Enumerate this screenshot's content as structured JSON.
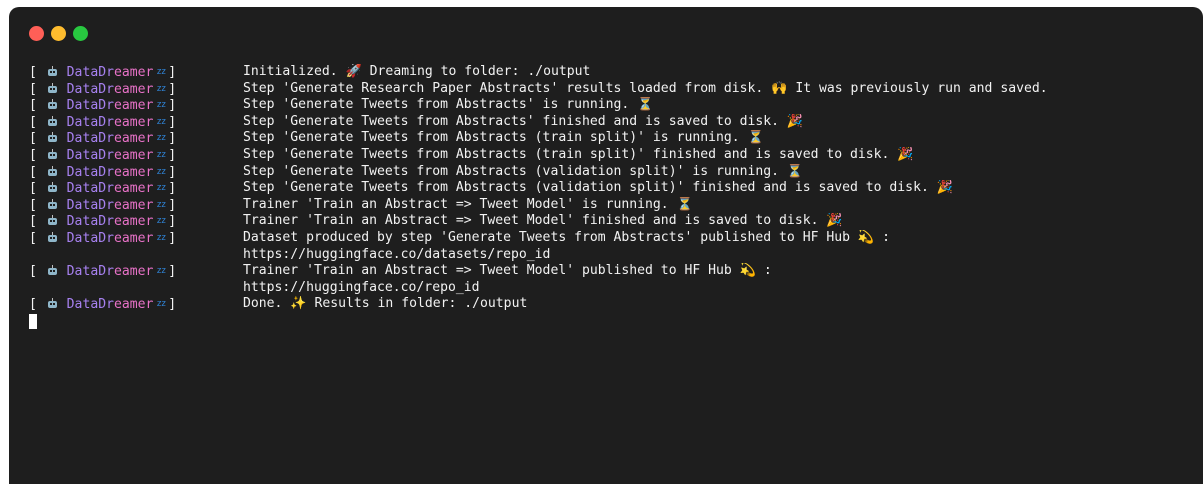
{
  "window": {
    "traffic_lights": {
      "close_color": "#ff5f57",
      "minimize_color": "#febc2e",
      "maximize_color": "#28c840"
    }
  },
  "prefix": {
    "open_bracket": "[",
    "brand_part_1": "DataDr",
    "brand_part_2": "eamer",
    "zzz_icon": "zz",
    "close_bracket": "]"
  },
  "lines": [
    {
      "msg": "Initialized. 🚀 Dreaming to folder: ./output"
    },
    {
      "msg": "Step 'Generate Research Paper Abstracts' results loaded from disk. 🙌 It was previously run and saved."
    },
    {
      "msg": "Step 'Generate Tweets from Abstracts' is running. ⏳"
    },
    {
      "msg": "Step 'Generate Tweets from Abstracts' finished and is saved to disk. 🎉"
    },
    {
      "msg": "Step 'Generate Tweets from Abstracts (train split)' is running. ⏳"
    },
    {
      "msg": "Step 'Generate Tweets from Abstracts (train split)' finished and is saved to disk. 🎉"
    },
    {
      "msg": "Step 'Generate Tweets from Abstracts (validation split)' is running. ⏳"
    },
    {
      "msg": "Step 'Generate Tweets from Abstracts (validation split)' finished and is saved to disk. 🎉"
    },
    {
      "msg": "Trainer 'Train an Abstract => Tweet Model' is running. ⏳"
    },
    {
      "msg": "Trainer 'Train an Abstract => Tweet Model' finished and is saved to disk. 🎉"
    },
    {
      "msg": "Dataset produced by step 'Generate Tweets from Abstracts' published to HF Hub 💫 :",
      "cont": "https://huggingface.co/datasets/repo_id"
    },
    {
      "msg": "Trainer 'Train an Abstract => Tweet Model' published to HF Hub 💫 :",
      "cont": "https://huggingface.co/repo_id"
    },
    {
      "msg": "Done. ✨ Results in folder: ./output"
    }
  ],
  "colors": {
    "background": "#1e1e1e",
    "text": "#f2f2f2",
    "brand_purple": "#a781f0",
    "brand_pink": "#e872c8",
    "zzz_blue": "#2f83d6"
  },
  "icons": [
    "robot-icon",
    "zzz-icon",
    "rocket-icon",
    "raised-hands-icon",
    "hourglass-icon",
    "party-popper-icon",
    "dizzy-icon",
    "sparkles-icon"
  ]
}
